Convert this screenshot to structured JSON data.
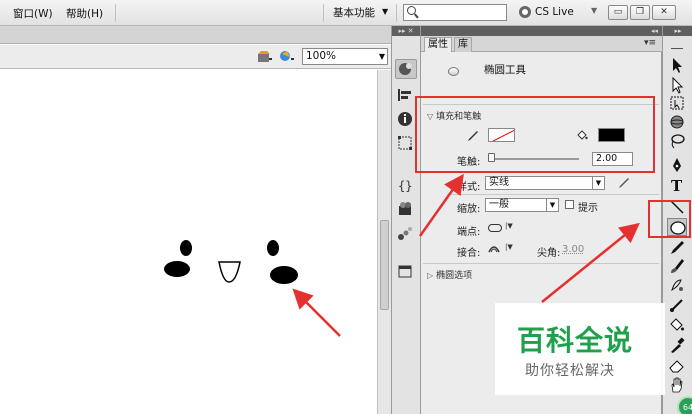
{
  "menubar": {
    "items": [
      "窗口(W)",
      "帮助(H)"
    ],
    "workspace": "基本功能",
    "search_placeholder": "",
    "cs_live": "CS Live"
  },
  "editbar": {
    "zoom": "100%"
  },
  "properties": {
    "tabs": [
      "属性",
      "库"
    ],
    "tool_name": "椭圆工具",
    "section_fill_stroke": "填充和笔触",
    "stroke_label": "笔触:",
    "stroke_value": "2.00",
    "style_label": "样式:",
    "style_value": "实线",
    "scale_label": "缩放:",
    "scale_value": "一般",
    "hint_label": "提示",
    "cap_label": "端点:",
    "join_label": "接合:",
    "miter_label": "尖角:",
    "miter_value": "3.00",
    "section_ellipse": "椭圆选项"
  },
  "colors": {
    "stroke_color": "none",
    "fill_color": "#000000",
    "annotation": "#e53030",
    "watermark": "#1fa04a"
  },
  "watermark": {
    "main": "百科全说",
    "sub": "助你轻松解决"
  },
  "badge": "64",
  "icons": [
    "search-icon",
    "cs-live-icon",
    "pencil-icon",
    "paint-bucket-icon",
    "ellipse-tool-icon",
    "selection-tool-icon",
    "text-tool-icon",
    "hand-tool-icon"
  ]
}
